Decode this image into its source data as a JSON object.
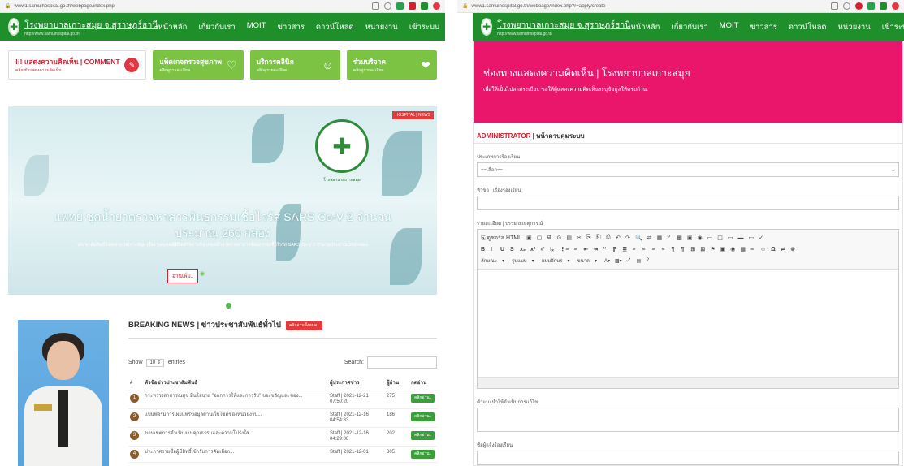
{
  "left": {
    "browser": {
      "url": "www1.samuihospital.go.th/webpage/index.php"
    },
    "header": {
      "site_name": "โรงพยาบาลเกาะสมุย จ.สุราษฎร์ธานี",
      "site_url": "http://www.samuihospital.go.th",
      "nav": [
        "หน้าหลัก",
        "เกี่ยวกับเรา",
        "MOIT",
        "ข่าวสาร",
        "ดาวน์โหลด",
        "หน่วยงาน",
        "เข้าระบบ"
      ]
    },
    "services": {
      "comment_title": "!!! แสดงความคิดเห็น | COMMENT",
      "comment_sub": "คลิกเข้าแสดงความคิดเห็น.",
      "svc1_title": "แพ็คเกจตรวจสุขภาพ",
      "svc1_sub": "คลิกดูรายละเอียด",
      "svc2_title": "บริการคลินิก",
      "svc2_sub": "คลิกดูรายละเอียด",
      "svc3_title": "ร่วมบริจาค",
      "svc3_sub": "คลิกดูรายละเอียด"
    },
    "banner": {
      "tag": "HOSPITAL | NEWS",
      "seal_caption": "โรงพยาบาลเกาะสมุย",
      "headline_1": "แพทย์ ชุดน้ำยาตรวจหาสารพันธุกรรมเชื้อไวรัส SARS Co-V 2 จำนวน",
      "headline_2": "ประมาณ 260 กล่อง",
      "sub": "ประชาสัมพันธ์โรงพยาบาลเกาะสมุย เรื่อง ขอบคุณผู้มีจิตศรัทธาบริจาคชุดน้ำยาตรวจหาสารพันธุกรรมเชื้อไวรัส SARS Co-V 2 จำนวนประมาณ 260 กล่อง",
      "read_more": "อ่านเพิ่ม.."
    },
    "news": {
      "title": "BREAKING NEWS | ข่าวประชาสัมพันธ์ทั่วไป",
      "all_button": "คลิกอ่านทั้งหมด..",
      "show_label": "Show",
      "entries_value": "10",
      "entries_label": "entries",
      "search_label": "Search:",
      "columns": [
        "#",
        "หัวข้อข่าวประชาสัมพันธ์",
        "ผู้ประกาศข่าว",
        "ผู้อ่าน",
        "กดอ่าน"
      ],
      "rows": [
        {
          "n": "1",
          "title": "กระทรวงสาธารณสุข มีนโยบาย \"ออกการให้และการรับ\" ของขวัญและของ...",
          "poster": "Staff | 2021-12-21 07:50:20",
          "views": "275",
          "btn": "คลิกอ่าน.."
        },
        {
          "n": "2",
          "title": "แบบฟอร์มการเผยแพร่ข้อมูลผ่านเว็บไซต์ของหน่วยงาน...",
          "poster": "Staff | 2021-12-16 04:54:33",
          "views": "186",
          "btn": "คลิกอ่าน.."
        },
        {
          "n": "3",
          "title": "ขอบเขตการดำเนินงานคุณธรรมและความโปร่งใส...",
          "poster": "Staff | 2021-12-16 04:29:08",
          "views": "202",
          "btn": "คลิกอ่าน.."
        },
        {
          "n": "4",
          "title": "ประกาศรายชื่อผู้มีสิทธิ์เข้ารับการคัดเลือก...",
          "poster": "Staff | 2021-12-01",
          "views": "305",
          "btn": "คลิกอ่าน.."
        }
      ]
    }
  },
  "right": {
    "browser": {
      "url": "www1.samuihospital.go.th/webpage/index.php?r=apply/create"
    },
    "header": {
      "site_name": "โรงพยาบาลเกาะสมุย จ.สุราษฎร์ธานี",
      "site_url": "http://www.samuihospital.go.th",
      "nav": [
        "หน้าหลัก",
        "เกี่ยวกับเรา",
        "MOIT",
        "ข่าวสาร",
        "ดาวน์โหลด",
        "หน่วยงาน",
        "เข้าระบบ"
      ]
    },
    "banner": {
      "heading": "ช่องทางแสดงความคิดเห็น | โรงพยาบาลเกาะสมุย",
      "desc": "เพื่อให้เป็นไปตามระเบียบ ขอให้ผู้แสดงความคิดเห็นระบุข้อมูลให้ครบถ้วน."
    },
    "admin_red": "ADMINISTRATOR",
    "admin_rest": "| หน้าควบคุมระบบ",
    "form": {
      "type_label": "ประเภทการร้องเรียน",
      "type_value": "==เลือก==",
      "subject_label": "หัวข้อ | เรื่องร้องเรียน",
      "details_label": "รายละเอียด | บรรยายเหตุการณ์",
      "toolbar_row1": [
        "⎘ ดูซอร์ส HTML",
        "▣",
        "▢",
        "⧉",
        "⊙",
        "▤",
        "✂",
        "⎘",
        "⎗",
        "⎙",
        "↶",
        "↷",
        "🔍",
        "⇄",
        "▦",
        "Ꭾ",
        "▩",
        "▣",
        "◉",
        "▭",
        "◫",
        "▭",
        "▬",
        "▭",
        "✓"
      ],
      "toolbar_row2": [
        "B",
        "I",
        "U",
        "S",
        "x₂",
        "x²",
        "✐",
        "Iₓ",
        "⋮≡",
        "≡",
        "⇤",
        "⇥",
        "❝",
        "⁋",
        "≣",
        "≡",
        "≡",
        "≡",
        "≡",
        "¶",
        "¶",
        "⊞",
        "⊠",
        "⚑",
        "▣",
        "◉",
        "▦",
        "≡",
        "☺",
        "Ω",
        "⇌",
        "⊗"
      ],
      "toolbar_row3": [
        "ลักษณะ",
        "▾",
        "รูปแบบ",
        "▾",
        "แบบอักษร",
        "▾",
        "ขนาด",
        "▾",
        "A▾",
        "▩▾",
        "⤢",
        "▤",
        "?"
      ],
      "suggest_label": "คำแนะนำให้ดำเนินการแก้ไข",
      "name_label": "ชื่อผู้แจ้งร้องเรียน"
    }
  }
}
